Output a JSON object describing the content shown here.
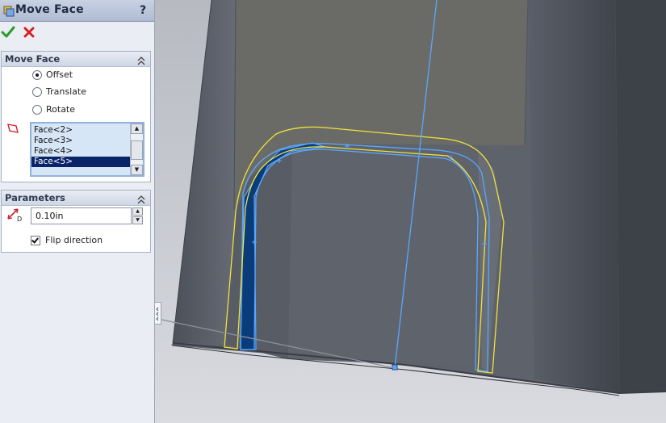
{
  "window": {
    "title": "Move Face",
    "help_label": "?"
  },
  "actions": {
    "ok": "check-icon",
    "cancel": "x-icon"
  },
  "move_face_group": {
    "header": "Move Face",
    "options": [
      "Offset",
      "Translate",
      "Rotate"
    ],
    "selected_option": "Offset",
    "faces": [
      "Face<2>",
      "Face<3>",
      "Face<4>",
      "Face<5>"
    ],
    "selected_face": "Face<5>"
  },
  "parameters_group": {
    "header": "Parameters",
    "distance_value": "0.10in",
    "flip_label": "Flip direction",
    "flip_checked": true
  },
  "colors": {
    "panel_bg": "#eaedf3",
    "title_bar": "#aebbd3",
    "list_selection": "#0a246a",
    "model_face": "#5f6570",
    "highlight_blue": "#5aa7ff",
    "preview_yellow": "#f2e23a",
    "selected_face_fill": "#0b3c7a",
    "background": "#c8cad0"
  }
}
